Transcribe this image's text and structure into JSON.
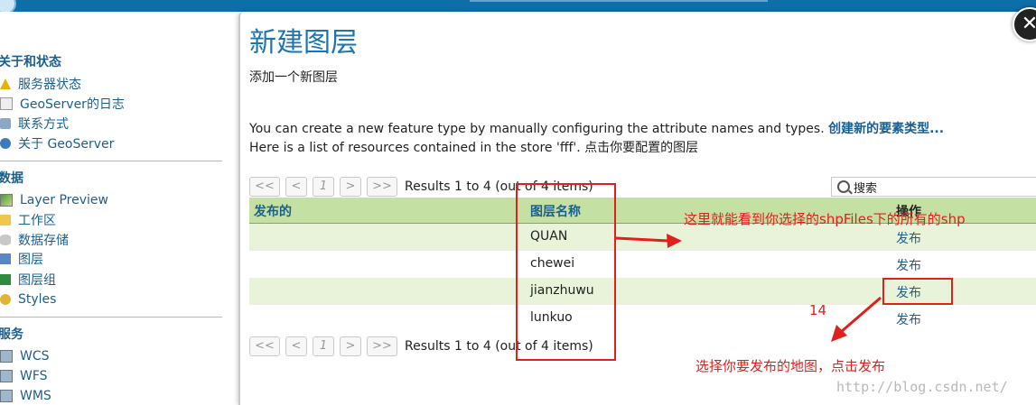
{
  "sidebar": {
    "sections": [
      {
        "title": "关于和状态",
        "items": [
          {
            "label": "服务器状态",
            "icon": "warning-icon"
          },
          {
            "label": "GeoServer的日志",
            "icon": "document-icon"
          },
          {
            "label": "联系方式",
            "icon": "contact-icon"
          },
          {
            "label": "关于 GeoServer",
            "icon": "globe-icon"
          }
        ]
      },
      {
        "title": "数据",
        "items": [
          {
            "label": "Layer Preview",
            "icon": "map-icon"
          },
          {
            "label": "工作区",
            "icon": "folder-icon"
          },
          {
            "label": "数据存储",
            "icon": "database-icon"
          },
          {
            "label": "图层",
            "icon": "layer-icon"
          },
          {
            "label": "图层组",
            "icon": "layer-group-icon"
          },
          {
            "label": "Styles",
            "icon": "style-icon"
          }
        ]
      },
      {
        "title": "服务",
        "items": [
          {
            "label": "WCS",
            "icon": "service-icon"
          },
          {
            "label": "WFS",
            "icon": "service-icon"
          },
          {
            "label": "WMS",
            "icon": "service-icon"
          }
        ]
      }
    ]
  },
  "main": {
    "title": "新建图层",
    "subtitle": "添加一个新图层",
    "desc1_text": "You can create a new feature type by manually configuring the attribute names and types.",
    "desc1_link": "创建新的要素类型...",
    "desc2": "Here is a list of resources contained in the store 'fff'. 点击你要配置的图层",
    "pager": {
      "first": "<<",
      "prev": "<",
      "page": "1",
      "next": ">",
      "last": ">>",
      "results": "Results 1 to 4 (out of 4 items)"
    },
    "search_placeholder": "搜索",
    "table": {
      "columns": [
        "发布的",
        "图层名称",
        "操作"
      ],
      "rows": [
        {
          "name": "QUAN",
          "action": "发布"
        },
        {
          "name": "chewei",
          "action": "发布"
        },
        {
          "name": "jianzhuwu",
          "action": "发布"
        },
        {
          "name": "lunkuo",
          "action": "发布"
        }
      ]
    }
  },
  "annotations": {
    "note1": "这里就能看到你选择的shpFiles下的所有的shp",
    "step": "14",
    "note2": "选择你要发布的地图，点击发布",
    "color": "#e0201c"
  },
  "watermark": "http://blog.csdn.net/",
  "colors": {
    "accent": "#1b5f8f",
    "header_green": "#c4e1a3",
    "row_alt": "#e8f3da",
    "title_blue": "#1b75b4"
  }
}
